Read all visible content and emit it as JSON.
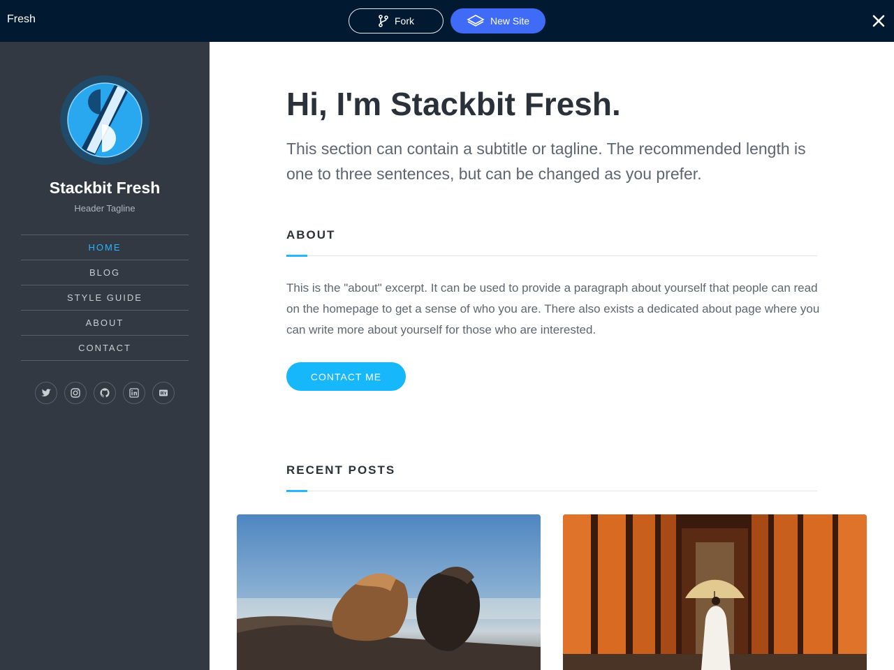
{
  "topbar": {
    "title": "Fresh",
    "fork_label": "Fork",
    "new_site_label": "New Site",
    "new_site_color": "#3f6bf7"
  },
  "sidebar": {
    "title": "Stackbit Fresh",
    "tagline": "Header Tagline",
    "nav": [
      {
        "label": "HOME",
        "active": true
      },
      {
        "label": "BLOG"
      },
      {
        "label": "STYLE GUIDE"
      },
      {
        "label": "ABOUT"
      },
      {
        "label": "CONTACT"
      }
    ],
    "social_icons": [
      "twitter-icon",
      "instagram-icon",
      "github-icon",
      "linkedin-icon",
      "dev-icon"
    ],
    "accent_color": "#26b6ff"
  },
  "main": {
    "hero_title": "Hi, I'm Stackbit Fresh.",
    "hero_subtitle": "This section can contain a subtitle or tagline. The recommended length is one to three sentences, but can be changed as you prefer.",
    "about_title": "ABOUT",
    "about_text": "This is the \"about\" excerpt. It can be used to provide a paragraph about yourself that people can read on the homepage to get a sense of who you are. There also exists a dedicated about page where you can write more about yourself for those who are interested.",
    "contact_button": "CONTACT ME",
    "recent_posts_title": "RECENT POSTS",
    "posts": [
      {
        "image": "horses-photo"
      },
      {
        "image": "torii-gates-photo"
      }
    ]
  }
}
